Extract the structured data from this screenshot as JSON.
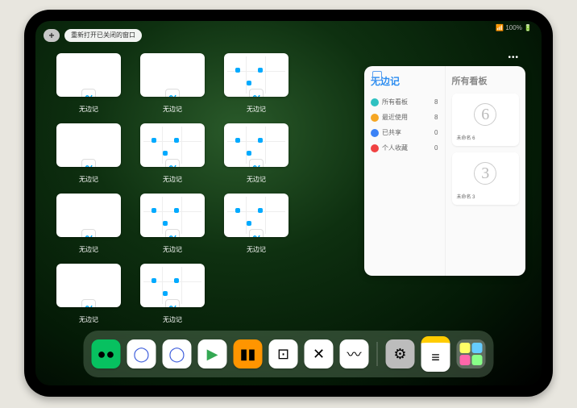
{
  "status": "📶 100% 🔋",
  "topbar": {
    "plus": "+",
    "reopen": "重新打开已关闭的窗口"
  },
  "app_label": "无边记",
  "panel": {
    "title": "无边记",
    "right_title": "所有看板",
    "items": [
      {
        "label": "所有看板",
        "count": "8",
        "color": "#2ec1c1"
      },
      {
        "label": "最近使用",
        "count": "8",
        "color": "#f5a623"
      },
      {
        "label": "已共享",
        "count": "0",
        "color": "#3b82f6"
      },
      {
        "label": "个人收藏",
        "count": "0",
        "color": "#f04242"
      }
    ],
    "cards": [
      {
        "name": "未命名 6",
        "digit": "6"
      },
      {
        "name": "未命名 3",
        "digit": "3"
      }
    ]
  },
  "dock": [
    {
      "name": "wechat",
      "bg": "#07c160",
      "glyph": "●●"
    },
    {
      "name": "quark-hd",
      "bg": "#fff",
      "glyph": "◯"
    },
    {
      "name": "quark",
      "bg": "#fff",
      "glyph": "◯"
    },
    {
      "name": "play",
      "bg": "#fff",
      "glyph": "▶"
    },
    {
      "name": "books",
      "bg": "#ff9500",
      "glyph": "▮▮"
    },
    {
      "name": "dice",
      "bg": "#fff",
      "glyph": "⊡"
    },
    {
      "name": "app-x",
      "bg": "#fff",
      "glyph": "✕"
    },
    {
      "name": "freeform",
      "bg": "#fff",
      "glyph": "〰"
    },
    {
      "name": "settings",
      "bg": "#bcbcbc",
      "glyph": "⚙"
    },
    {
      "name": "notes",
      "bg": "#fff",
      "glyph": "≡"
    }
  ]
}
